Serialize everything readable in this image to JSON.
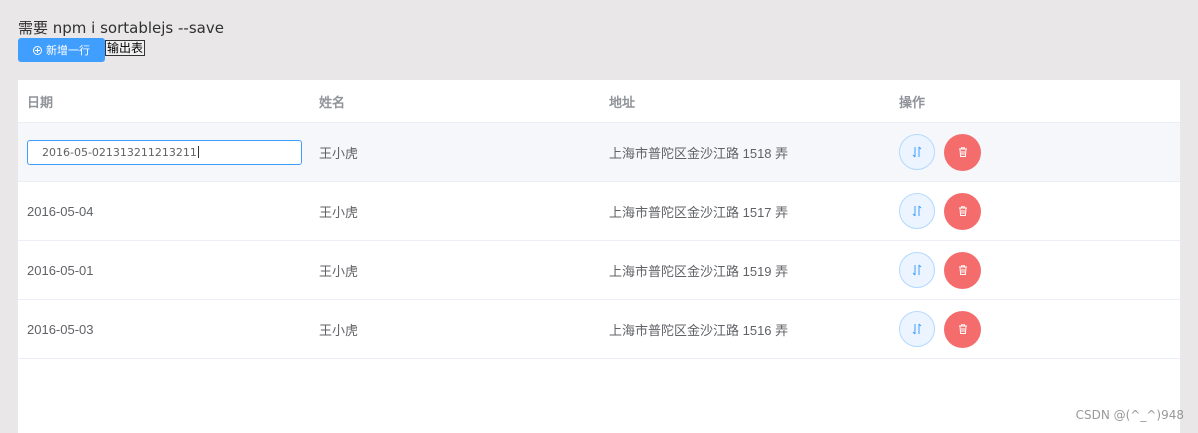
{
  "note": "需要 npm i sortablejs --save",
  "buttons": {
    "add_row": "新增一行",
    "export": "输出表"
  },
  "table": {
    "headers": [
      "日期",
      "姓名",
      "地址",
      "操作"
    ],
    "rows": [
      {
        "date": "2016-05-021313211213211",
        "name": "王小虎",
        "address": "上海市普陀区金沙江路 1518 弄",
        "editing": true
      },
      {
        "date": "2016-05-04",
        "name": "王小虎",
        "address": "上海市普陀区金沙江路 1517 弄"
      },
      {
        "date": "2016-05-01",
        "name": "王小虎",
        "address": "上海市普陀区金沙江路 1519 弄"
      },
      {
        "date": "2016-05-03",
        "name": "王小虎",
        "address": "上海市普陀区金沙江路 1516 弄"
      }
    ]
  },
  "watermark": "CSDN @(^_^)948",
  "colors": {
    "primary": "#409eff",
    "danger": "#f56c6c",
    "page_bg": "#e9e7e7"
  },
  "icons": {
    "add": "plus-circle-icon",
    "sort": "sort-arrows-icon",
    "delete": "trash-icon"
  }
}
